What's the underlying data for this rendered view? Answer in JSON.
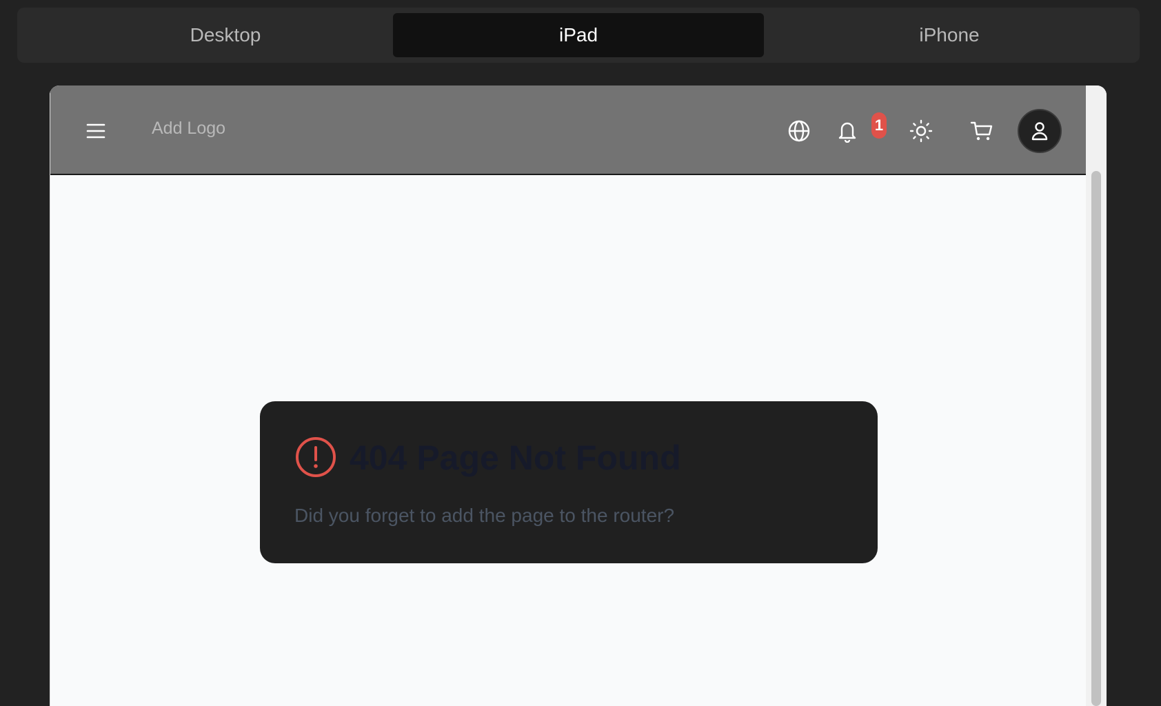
{
  "device_switcher": {
    "tabs": [
      {
        "label": "Desktop",
        "active": false
      },
      {
        "label": "iPad",
        "active": true
      },
      {
        "label": "iPhone",
        "active": false
      }
    ]
  },
  "header": {
    "logo_text": "Add Logo",
    "icons": [
      "menu-icon",
      "globe-icon",
      "bell-icon",
      "sun-icon",
      "cart-icon",
      "user-icon"
    ],
    "notification_count": "1",
    "badge_color": "#e0524a",
    "background_color": "#737373"
  },
  "error_card": {
    "title": "404 Page Not Found",
    "message": "Did you forget to add the page to the router?",
    "icon": "alert-circle-icon",
    "icon_color": "#e0524a"
  }
}
